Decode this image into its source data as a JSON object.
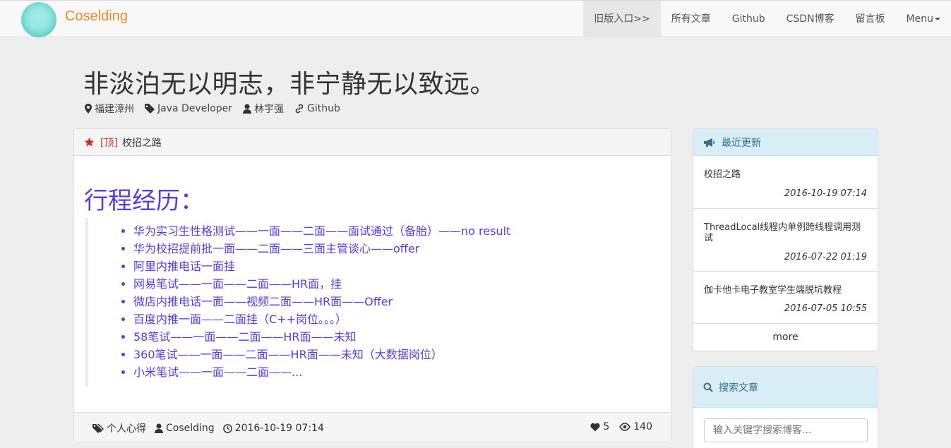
{
  "brand": "Coselding",
  "nav": [
    "旧版入口>>",
    "所有文章",
    "Github",
    "CSDN博客",
    "留言板",
    "Menu"
  ],
  "motto": "非淡泊无以明志，非宁静无以致远。",
  "profile": {
    "location": "福建漳州",
    "job": "Java Developer",
    "name": "林宇强",
    "link": "Github"
  },
  "article": {
    "top_tag": "[顶]",
    "title": "校招之路",
    "heading": "行程经历：",
    "items": [
      "华为实习生性格测试——一面——二面——面试通过（备胎）——no result",
      "华为校招提前批一面——二面——三面主管谈心——offer",
      "阿里内推电话一面挂",
      "网易笔试——一面——二面——HR面，挂",
      "微店内推电话一面——视频二面——HR面——Offer",
      "百度内推一面——二面挂（C++岗位。。。）",
      "58笔试——一面——二面——HR面——未知",
      "360笔试——一面——二面——HR面——未知（大数据岗位）",
      "小米笔试——一面——二面——..."
    ],
    "category": "个人心得",
    "author": "Coselding",
    "date": "2016-10-19 07:14",
    "likes": "5",
    "views": "140"
  },
  "recent": {
    "title": "最近更新",
    "items": [
      {
        "title": "校招之路",
        "date": "2016-10-19 07:14"
      },
      {
        "title": "ThreadLocal线程内单例跨线程调用测试",
        "date": "2016-07-22 01:19"
      },
      {
        "title": "伽卡他卡电子教室学生端脱坑教程",
        "date": "2016-07-05 10:55"
      }
    ],
    "more": "more"
  },
  "search": {
    "title": "搜索文章",
    "placeholder": "输入关键字搜索博客..."
  },
  "colors": {
    "brand": "#e8892c",
    "accent_purple": "#5a39e6",
    "top_red": "#c9302c",
    "info_bg": "#d9edf7",
    "info_text": "#31708f"
  }
}
